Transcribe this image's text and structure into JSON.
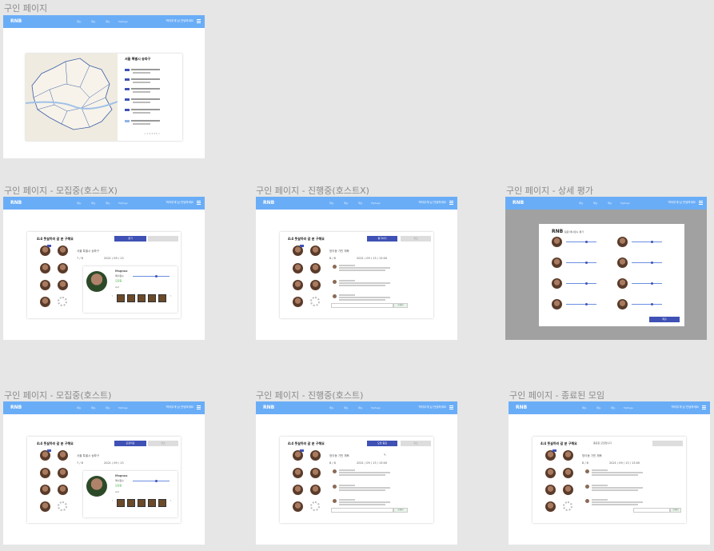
{
  "frames": [
    {
      "label": "구인 페이지"
    },
    {
      "label": "구인 페이지 - 모집중(호스트X)"
    },
    {
      "label": "구인 페이지 - 진행중(호스트X)"
    },
    {
      "label": "구인 페이지 - 상세 평가"
    },
    {
      "label": "구인 페이지 - 모집중(호스트)"
    },
    {
      "label": "구인 페이지 - 진행중(호스트)"
    },
    {
      "label": "구인 페이지 - 종료된 모임"
    }
  ],
  "nav": {
    "logo": "RNB",
    "menu": [
      "메뉴",
      "메뉴",
      "메뉴",
      "MyPage"
    ],
    "user": "박아무개 님 안녕하세요"
  },
  "main_page": {
    "list_title": "서울 특별시 송파구",
    "pagination": "< 1 2 3 4 5 >"
  },
  "recruit": {
    "title": "4:4 풋살하러 갈 분 구해요",
    "location": "서울 특별시 송파구",
    "count": "7 / 8",
    "date": "2021 / 09 / 13",
    "join_button": "참가",
    "host_button": "모집마감",
    "profile_name": "Magnus",
    "rating_label": "매너점수",
    "rating_value": "4.2",
    "status_badge": "모집중",
    "cancel_button": "취소"
  },
  "progress": {
    "title": "4:4 풋살하러 갈 분 구해요",
    "location": "방이동 기민 체육",
    "count": "8 / 8",
    "date": "2021 / 09 / 13 / 13:00",
    "eval_button": "평가하기",
    "host_button": "모임 종료",
    "cancel_button": "취소",
    "send_button": "보내기"
  },
  "detail": {
    "logo": "RNB",
    "title": "팀원 매너점수 평가",
    "submit_button": "제출"
  },
  "ended": {
    "title": "4:4 풋살하러 갈 분 구해요",
    "status": "종료된 모임입니다",
    "location": "방이동 기민 체육",
    "count": "8 / 8",
    "date": "2021 / 09 / 13 / 13:00",
    "send_button": "보내기"
  },
  "colors": {
    "nav": "#6aadf7",
    "accent": "#3f51b5",
    "background": "#e6e6e6"
  }
}
